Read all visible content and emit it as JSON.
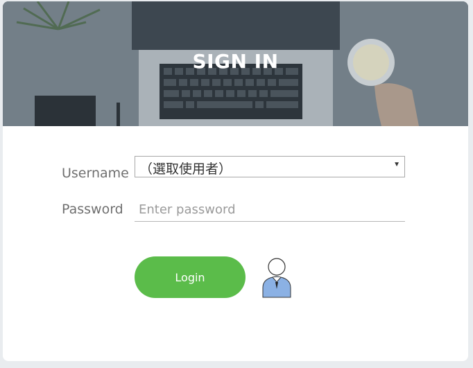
{
  "header": {
    "title": "SIGN IN",
    "background": "laptop-desk-photo"
  },
  "form": {
    "username_label": "Username",
    "username_selected": "（選取使用者）",
    "password_label": "Password",
    "password_placeholder": "Enter password",
    "login_label": "Login"
  },
  "colors": {
    "accent": "#5bbc4a",
    "hero_overlay": "#6f7b84"
  },
  "icons": {
    "user": "user-avatar-icon",
    "dropdown": "caret-down-icon"
  }
}
